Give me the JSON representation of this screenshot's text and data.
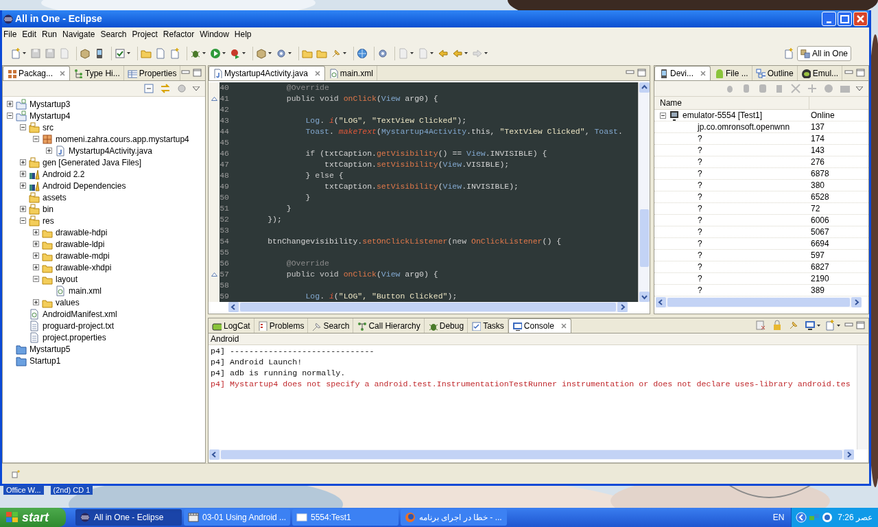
{
  "window": {
    "title": "All in One - Eclipse"
  },
  "menu": [
    "File",
    "Edit",
    "Run",
    "Navigate",
    "Search",
    "Project",
    "Refactor",
    "Window",
    "Help"
  ],
  "perspective": {
    "label": "All in One"
  },
  "left_pane": {
    "tabs": [
      {
        "label": "Packag...",
        "selected": true
      },
      {
        "label": "Type Hi...",
        "selected": false
      },
      {
        "label": "Properties",
        "selected": false
      }
    ],
    "tree": [
      {
        "label": "Mystartup3",
        "kind": "project",
        "expanded": false
      },
      {
        "label": "Mystartup4",
        "kind": "project",
        "expanded": true,
        "children": [
          {
            "label": "src",
            "kind": "source-folder",
            "expanded": true,
            "children": [
              {
                "label": "momeni.zahra.cours.app.mystartup4",
                "kind": "package",
                "expanded": true,
                "children": [
                  {
                    "label": "Mystartup4Activity.java",
                    "kind": "java",
                    "expanded": false
                  }
                ]
              }
            ]
          },
          {
            "label": "gen [Generated Java Files]",
            "kind": "source-folder",
            "expanded": false
          },
          {
            "label": "Android 2.2",
            "kind": "library",
            "expanded": false
          },
          {
            "label": "Android Dependencies",
            "kind": "library",
            "expanded": false
          },
          {
            "label": "assets",
            "kind": "source-folder"
          },
          {
            "label": "bin",
            "kind": "source-folder",
            "expanded": false
          },
          {
            "label": "res",
            "kind": "source-folder",
            "expanded": true,
            "children": [
              {
                "label": "drawable-hdpi",
                "kind": "folder",
                "expanded": false
              },
              {
                "label": "drawable-ldpi",
                "kind": "folder",
                "expanded": false
              },
              {
                "label": "drawable-mdpi",
                "kind": "folder",
                "expanded": false
              },
              {
                "label": "drawable-xhdpi",
                "kind": "folder",
                "expanded": false
              },
              {
                "label": "layout",
                "kind": "folder",
                "expanded": true,
                "children": [
                  {
                    "label": "main.xml",
                    "kind": "xml"
                  }
                ]
              },
              {
                "label": "values",
                "kind": "folder",
                "expanded": false
              }
            ]
          },
          {
            "label": "AndroidManifest.xml",
            "kind": "xml"
          },
          {
            "label": "proguard-project.txt",
            "kind": "text"
          },
          {
            "label": "project.properties",
            "kind": "text"
          }
        ]
      },
      {
        "label": "Mystartup5",
        "kind": "closed-project"
      },
      {
        "label": "Startup1",
        "kind": "closed-project"
      }
    ]
  },
  "editor": {
    "tabs": [
      {
        "label": "Mystartup4Activity.java",
        "selected": true
      },
      {
        "label": "main.xml",
        "selected": false
      }
    ],
    "lines": [
      {
        "number": "40",
        "override": false,
        "segments": [
          {
            "text": "            @Override",
            "kind": "ann"
          }
        ]
      },
      {
        "number": "41",
        "override": true,
        "segments": [
          {
            "text": "            public void ",
            "kind": "kw"
          },
          {
            "text": "onClick",
            "kind": "method"
          },
          {
            "text": "(",
            "kind": "plain"
          },
          {
            "text": "View",
            "kind": "type"
          },
          {
            "text": " arg0) {",
            "kind": "plain"
          }
        ]
      },
      {
        "number": "42",
        "override": false
      },
      {
        "number": "43",
        "override": false,
        "segments": [
          {
            "text": "                Log",
            "kind": "type"
          },
          {
            "text": ". ",
            "kind": "plain"
          },
          {
            "text": "i",
            "kind": "static"
          },
          {
            "text": "(",
            "kind": "plain"
          },
          {
            "text": "\"LOG\", \"TextView Clicked\"",
            "kind": "str"
          },
          {
            "text": ");",
            "kind": "plain"
          }
        ]
      },
      {
        "number": "44",
        "override": false,
        "segments": [
          {
            "text": "                Toast",
            "kind": "type"
          },
          {
            "text": ". ",
            "kind": "plain"
          },
          {
            "text": "makeText",
            "kind": "static"
          },
          {
            "text": "(",
            "kind": "plain"
          },
          {
            "text": "Mystartup4Activity",
            "kind": "type"
          },
          {
            "text": ".this, ",
            "kind": "plain"
          },
          {
            "text": "\"TextView Clicked\"",
            "kind": "str"
          },
          {
            "text": ", ",
            "kind": "plain"
          },
          {
            "text": "Toast",
            "kind": "type"
          },
          {
            "text": ".",
            "kind": "plain"
          }
        ]
      },
      {
        "number": "45",
        "override": false
      },
      {
        "number": "46",
        "override": false,
        "segments": [
          {
            "text": "                if",
            "kind": "kw"
          },
          {
            "text": " (txtCaption.",
            "kind": "plain"
          },
          {
            "text": "getVisibility",
            "kind": "method"
          },
          {
            "text": "() == ",
            "kind": "plain"
          },
          {
            "text": "View",
            "kind": "type"
          },
          {
            "text": ".INVISIBLE) {",
            "kind": "plain"
          }
        ]
      },
      {
        "number": "47",
        "override": false,
        "segments": [
          {
            "text": "                    txtCaption.",
            "kind": "plain"
          },
          {
            "text": "setVisibility",
            "kind": "method"
          },
          {
            "text": "(",
            "kind": "plain"
          },
          {
            "text": "View",
            "kind": "type"
          },
          {
            "text": ".VISIBLE);",
            "kind": "plain"
          }
        ]
      },
      {
        "number": "48",
        "override": false,
        "segments": [
          {
            "text": "                } ",
            "kind": "plain"
          },
          {
            "text": "else",
            "kind": "kw"
          },
          {
            "text": " {",
            "kind": "plain"
          }
        ]
      },
      {
        "number": "49",
        "override": false,
        "segments": [
          {
            "text": "                    txtCaption.",
            "kind": "plain"
          },
          {
            "text": "setVisibility",
            "kind": "method"
          },
          {
            "text": "(",
            "kind": "plain"
          },
          {
            "text": "View",
            "kind": "type"
          },
          {
            "text": ".INVISIBLE);",
            "kind": "plain"
          }
        ]
      },
      {
        "number": "50",
        "override": false,
        "segments": [
          {
            "text": "                }",
            "kind": "plain"
          }
        ]
      },
      {
        "number": "51",
        "override": false,
        "segments": [
          {
            "text": "            }",
            "kind": "plain"
          }
        ]
      },
      {
        "number": "52",
        "override": false,
        "segments": [
          {
            "text": "        });",
            "kind": "plain"
          }
        ]
      },
      {
        "number": "53",
        "override": false
      },
      {
        "number": "54",
        "override": false,
        "segments": [
          {
            "text": "        btnChangevisibility.",
            "kind": "plain"
          },
          {
            "text": "setOnClickListener",
            "kind": "method"
          },
          {
            "text": "(",
            "kind": "plain"
          },
          {
            "text": "new ",
            "kind": "kw"
          },
          {
            "text": "OnClickListener",
            "kind": "method"
          },
          {
            "text": "() {",
            "kind": "plain"
          }
        ]
      },
      {
        "number": "55",
        "override": false
      },
      {
        "number": "56",
        "override": false,
        "segments": [
          {
            "text": "            @Override",
            "kind": "ann"
          }
        ]
      },
      {
        "number": "57",
        "override": true,
        "segments": [
          {
            "text": "            public void ",
            "kind": "kw"
          },
          {
            "text": "onClick",
            "kind": "method"
          },
          {
            "text": "(",
            "kind": "plain"
          },
          {
            "text": "View",
            "kind": "type"
          },
          {
            "text": " arg0) {",
            "kind": "plain"
          }
        ]
      },
      {
        "number": "58",
        "override": false
      },
      {
        "number": "59",
        "override": false,
        "segments": [
          {
            "text": "                Log",
            "kind": "type"
          },
          {
            "text": ". ",
            "kind": "plain"
          },
          {
            "text": "i",
            "kind": "static"
          },
          {
            "text": "(",
            "kind": "plain"
          },
          {
            "text": "\"LOG\", \"Button Clicked\"",
            "kind": "str"
          },
          {
            "text": ");",
            "kind": "plain"
          }
        ]
      }
    ]
  },
  "right_pane": {
    "tabs": [
      {
        "label": "Devi...",
        "selected": true
      },
      {
        "label": "File ...",
        "selected": false
      },
      {
        "label": "Outline",
        "selected": false
      },
      {
        "label": "Emul...",
        "selected": false
      }
    ],
    "columns": [
      "Name"
    ],
    "device": {
      "name": "emulator-5554 [Test1]",
      "status": "Online",
      "expanded": true,
      "processes": [
        {
          "name": "jp.co.omronsoft.openwnn",
          "pid": "137"
        },
        {
          "name": "?",
          "pid": "174"
        },
        {
          "name": "?",
          "pid": "143"
        },
        {
          "name": "?",
          "pid": "276"
        },
        {
          "name": "?",
          "pid": "6878"
        },
        {
          "name": "?",
          "pid": "380"
        },
        {
          "name": "?",
          "pid": "6528"
        },
        {
          "name": "?",
          "pid": "72"
        },
        {
          "name": "?",
          "pid": "6006"
        },
        {
          "name": "?",
          "pid": "5067"
        },
        {
          "name": "?",
          "pid": "6694"
        },
        {
          "name": "?",
          "pid": "597"
        },
        {
          "name": "?",
          "pid": "6827"
        },
        {
          "name": "?",
          "pid": "2190"
        },
        {
          "name": "?",
          "pid": "389"
        }
      ]
    }
  },
  "bottom_pane": {
    "tabs": [
      {
        "label": "LogCat",
        "selected": false
      },
      {
        "label": "Problems",
        "selected": false
      },
      {
        "label": "Search",
        "selected": false
      },
      {
        "label": "Call Hierarchy",
        "selected": false
      },
      {
        "label": "Debug",
        "selected": false
      },
      {
        "label": "Tasks",
        "selected": false
      },
      {
        "label": "Console",
        "selected": true
      }
    ],
    "console_name": "Android",
    "lines": [
      {
        "text": "p4] ------------------------------",
        "kind": "info"
      },
      {
        "text": "p4] Android Launch!",
        "kind": "info"
      },
      {
        "text": "p4] adb is running normally.",
        "kind": "info"
      },
      {
        "text": "p4] Mystartup4 does not specify a android.test.InstrumentationTestRunner instrumentation or does not declare uses-library android.tes",
        "kind": "error"
      }
    ]
  },
  "desktop_labels": [
    "Office W...",
    "(2nd) CD 1"
  ],
  "taskbar": {
    "start": "start",
    "items": [
      {
        "label": "All in One - Eclipse",
        "selected": true,
        "kind": "eclipse"
      },
      {
        "label": "03-01 Using Android ...",
        "selected": false,
        "kind": "video"
      },
      {
        "label": "5554:Test1",
        "selected": false,
        "kind": "window"
      },
      {
        "label": "خطا در اجرای برنامه - ...",
        "selected": false,
        "kind": "browser"
      }
    ],
    "language": "EN",
    "clock": "7:26 عصر"
  }
}
